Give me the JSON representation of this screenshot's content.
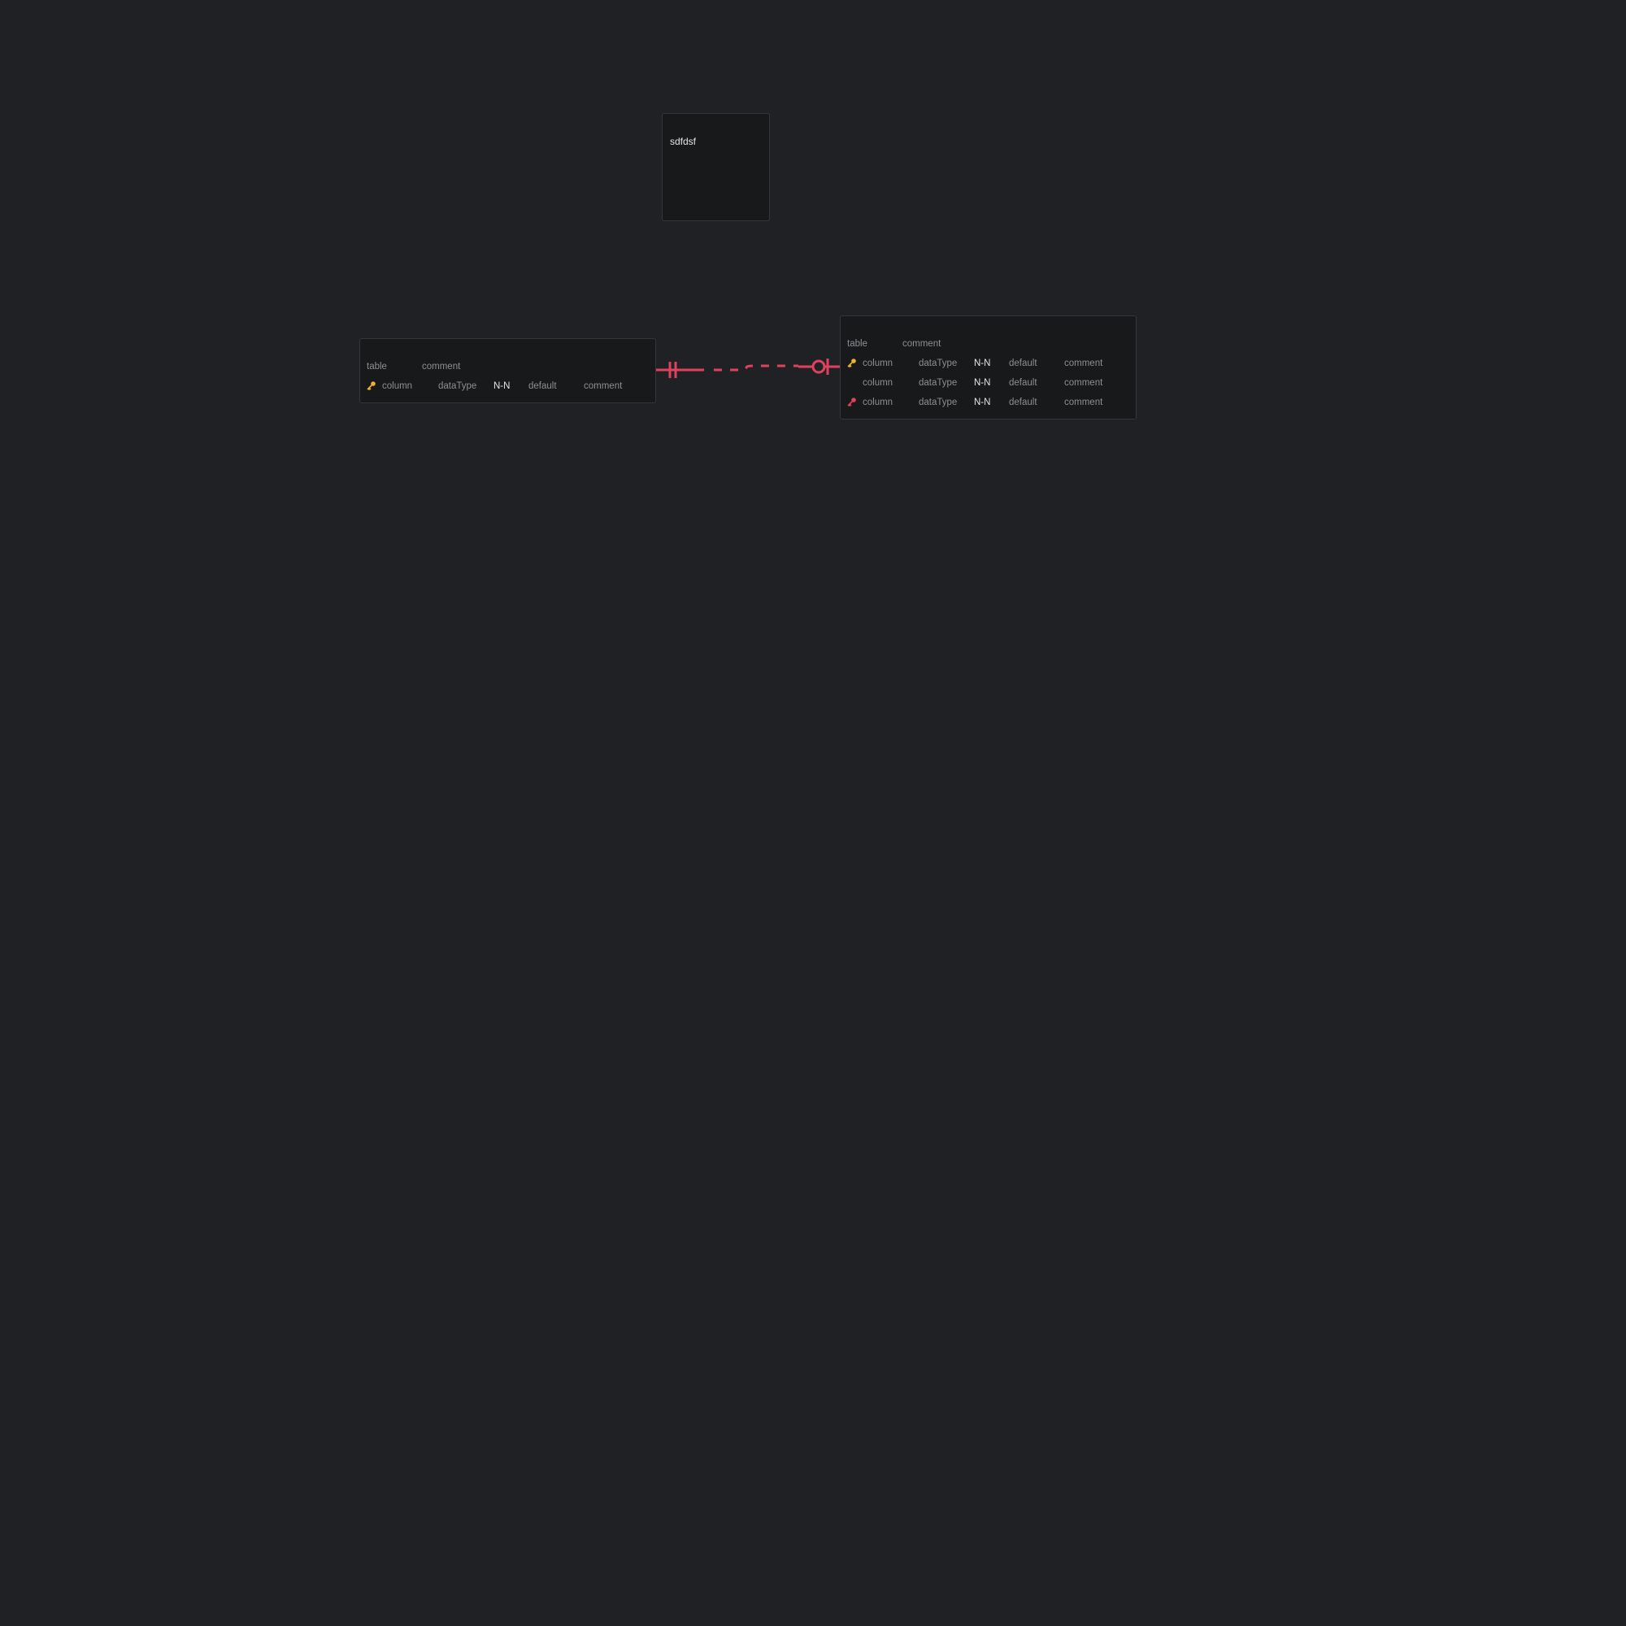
{
  "memo": {
    "text": "sdfdsf"
  },
  "tables": [
    {
      "name": "table",
      "comment": "comment",
      "columns": [
        {
          "key": "primary",
          "name": "column",
          "dataType": "dataType",
          "notNull": "N-N",
          "default": "default",
          "comment": "comment"
        }
      ]
    },
    {
      "name": "table",
      "comment": "comment",
      "columns": [
        {
          "key": "primary",
          "name": "column",
          "dataType": "dataType",
          "notNull": "N-N",
          "default": "default",
          "comment": "comment"
        },
        {
          "key": "none",
          "name": "column",
          "dataType": "dataType",
          "notNull": "N-N",
          "default": "default",
          "comment": "comment"
        },
        {
          "key": "foreign",
          "name": "column",
          "dataType": "dataType",
          "notNull": "N-N",
          "default": "default",
          "comment": "comment"
        }
      ]
    }
  ],
  "relationship": {
    "start_cardinality": "one-only",
    "end_cardinality": "zero-or-one",
    "line_style": "dashed"
  },
  "colors": {
    "background": "#202125",
    "table_bg": "#18191b",
    "border": "#34363b",
    "text_muted": "#8e8f93",
    "text_bright": "#e6e6e6",
    "primary_key": "#f0b429",
    "foreign_key": "#e0425e",
    "relationship": "#e0425e"
  }
}
